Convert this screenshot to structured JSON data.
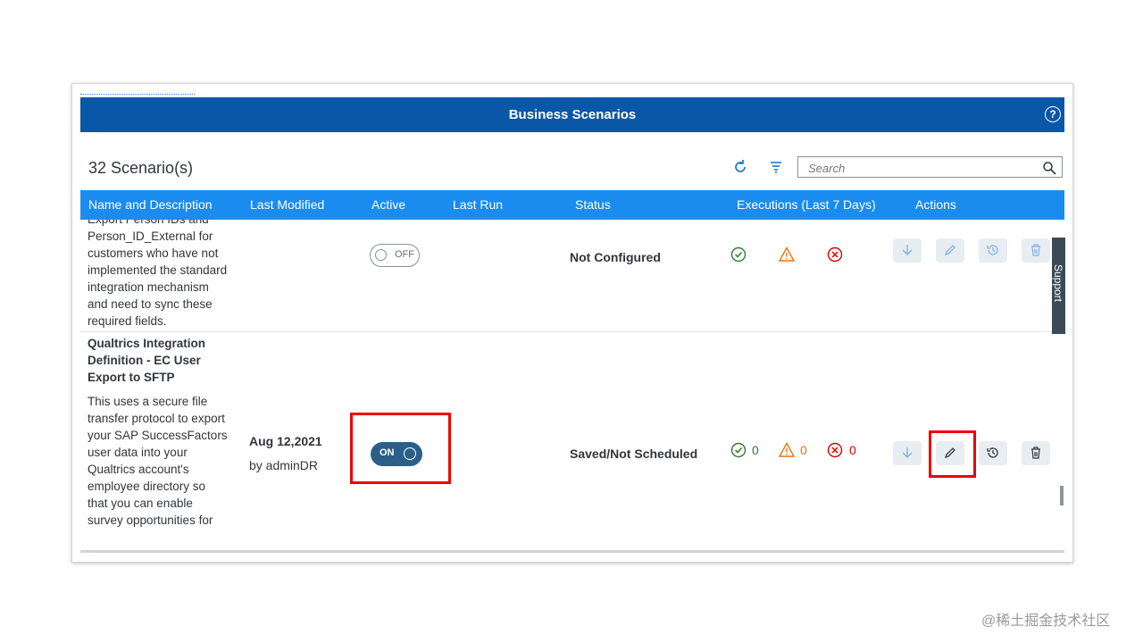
{
  "window": {
    "title": "Business Scenarios"
  },
  "toolbar": {
    "count_label": "32 Scenario(s)",
    "search_placeholder": "Search"
  },
  "columns": [
    "Name and Description",
    "Last Modified",
    "Active",
    "Last Run",
    "Status",
    "Executions (Last 7 Days)",
    "Actions"
  ],
  "rows": [
    {
      "title": "",
      "desc_lines": [
        "Export Person IDs and",
        "Person_ID_External for",
        "customers who have not",
        "implemented the standard",
        "integration mechanism",
        "and need to sync these",
        "required fields."
      ],
      "last_modified_date": "",
      "last_modified_by": "",
      "active_label": "OFF",
      "last_run": "",
      "status": "Not Configured",
      "executions": {
        "success": "",
        "warning": "",
        "error": ""
      }
    },
    {
      "title_lines": [
        "Qualtrics Integration",
        "Definition - EC User",
        "Export to SFTP"
      ],
      "desc_lines": [
        "This uses a secure file",
        "transfer protocol to export",
        "your SAP SuccessFactors",
        "user data into your",
        "Qualtrics account's",
        "employee directory so",
        "that you can enable",
        "survey opportunities for"
      ],
      "last_modified_date": "Aug 12,2021",
      "last_modified_by": "by adminDR",
      "active_label": "ON",
      "last_run": "",
      "status": "Saved/Not Scheduled",
      "executions": {
        "success": "0",
        "warning": "0",
        "error": "0"
      }
    }
  ],
  "side_tab": "Support",
  "watermark": "@稀土掘金技术社区",
  "colors": {
    "header": "#0a57a8",
    "table_header": "#1a8cf0",
    "success": "#2b7d2b",
    "warning": "#e9730c",
    "error": "#e00000",
    "highlight": "#e00000"
  }
}
